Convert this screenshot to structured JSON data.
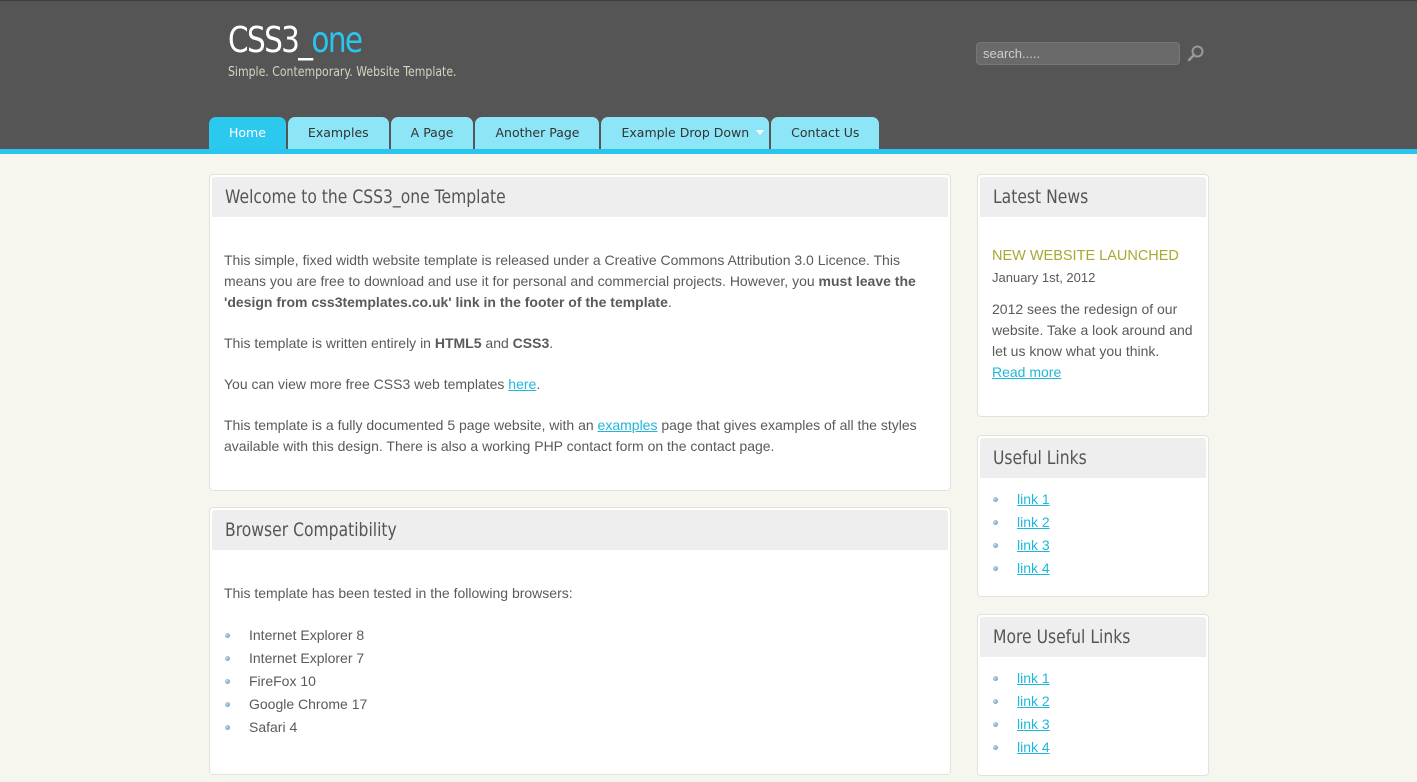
{
  "site": {
    "logo_main": "CSS3_",
    "logo_accent": "one",
    "slogan": "Simple. Contemporary. Website Template.",
    "search_placeholder": "search.....",
    "accent_color": "#29c5ee"
  },
  "nav": {
    "items": [
      {
        "label": "Home"
      },
      {
        "label": "Examples"
      },
      {
        "label": "A Page"
      },
      {
        "label": "Another Page"
      },
      {
        "label": "Example Drop Down"
      },
      {
        "label": "Contact Us"
      }
    ]
  },
  "welcome": {
    "title": "Welcome to the CSS3_one Template",
    "p1_a": "This simple, fixed width website template is released under a Creative Commons Attribution 3.0 Licence. This means you are free to download and use it for personal and commercial projects. However, you ",
    "p1_b": "must leave the 'design from css3templates.co.uk' link in the footer of the template",
    "p1_c": ".",
    "p2_a": "This template is written entirely in ",
    "p2_b": "HTML5",
    "p2_c": " and ",
    "p2_d": "CSS3",
    "p2_e": ".",
    "p3_a": "You can view more free CSS3 web templates ",
    "p3_link": "here",
    "p3_c": ".",
    "p4_a": "This template is a fully documented 5 page website, with an ",
    "p4_link": "examples",
    "p4_c": " page that gives examples of all the styles available with this design. There is also a working PHP contact form on the contact page."
  },
  "browsers": {
    "title": "Browser Compatibility",
    "intro": "This template has been tested in the following browsers:",
    "items": [
      "Internet Explorer 8",
      "Internet Explorer 7",
      "FireFox 10",
      "Google Chrome 17",
      "Safari 4"
    ]
  },
  "news": {
    "title": "Latest News",
    "headline": "NEW WEBSITE LAUNCHED",
    "date": "January 1st, 2012",
    "text": "2012 sees the redesign of our website. Take a look around and let us know what you think.",
    "read_more": "Read more"
  },
  "useful_links": {
    "title": "Useful Links",
    "items": [
      "link 1",
      "link 2",
      "link 3",
      "link 4"
    ]
  },
  "more_links": {
    "title": "More Useful Links",
    "items": [
      "link 1",
      "link 2",
      "link 3",
      "link 4"
    ]
  }
}
